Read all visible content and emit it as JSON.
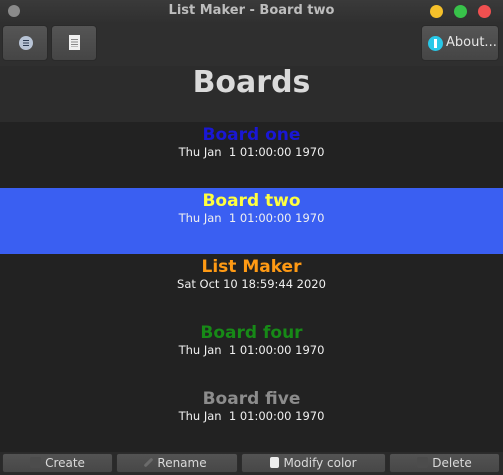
{
  "window": {
    "title": "List Maker - Board two",
    "colors": {
      "close": "#f05050",
      "maximize": "#38c24a",
      "minimize": "#f5c02a"
    }
  },
  "toolbar": {
    "menu_icon": "hamburger-menu-icon",
    "doc_icon": "document-icon",
    "about_label": "About...",
    "about_icon": "info-icon"
  },
  "header": {
    "title": "Boards"
  },
  "boards": [
    {
      "name": "Board one",
      "date": "Thu Jan  1 01:00:00 1970",
      "color": "#1a17d4",
      "selected": false
    },
    {
      "name": "Board two",
      "date": "Thu Jan  1 01:00:00 1970",
      "color": "#ffff40",
      "selected": true
    },
    {
      "name": "List Maker",
      "date": "Sat Oct 10 18:59:44 2020",
      "color": "#ff9a14",
      "selected": false
    },
    {
      "name": "Board four",
      "date": "Thu Jan  1 01:00:00 1970",
      "color": "#178a17",
      "selected": false
    },
    {
      "name": "Board five",
      "date": "Thu Jan  1 01:00:00 1970",
      "color": "#8c8c8c",
      "selected": false
    }
  ],
  "selection_color": "#3a5ff2",
  "actions": {
    "create_label": "Create",
    "rename_label": "Rename",
    "modify_color_label": "Modify color",
    "delete_label": "Delete"
  }
}
